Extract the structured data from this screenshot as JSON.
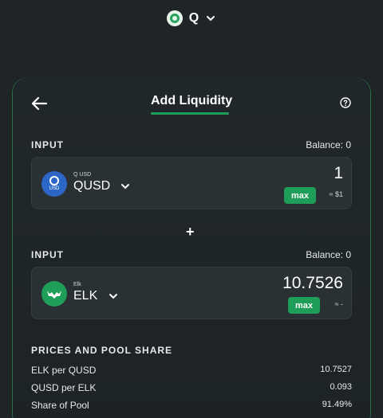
{
  "network": {
    "label": "Q",
    "icon": "q-network-icon"
  },
  "header": {
    "title": "Add Liquidity",
    "back_icon": "arrow-left-icon",
    "help_icon": "help-circle-icon"
  },
  "input1": {
    "label": "INPUT",
    "balance": "Balance: 0",
    "token_small": "Q USD",
    "token_name": "QUSD",
    "amount": "1",
    "max_label": "max",
    "usd_estimate": "≈ $1"
  },
  "plus": "+",
  "input2": {
    "label": "INPUT",
    "balance": "Balance: 0",
    "token_small": "Elk",
    "token_name": "ELK",
    "amount": "10.7526",
    "max_label": "max",
    "usd_estimate": "≈ -"
  },
  "prices": {
    "title": "PRICES AND POOL SHARE",
    "rows": [
      {
        "label": "ELK per QUSD",
        "value": "10.7527"
      },
      {
        "label": "QUSD per ELK",
        "value": "0.093"
      },
      {
        "label": "Share of Pool",
        "value": "91.49%"
      }
    ]
  },
  "colors": {
    "accent": "#1f9e59",
    "background": "#1f2426",
    "panel": "#2a3134",
    "qusd": "#2c67c8"
  }
}
